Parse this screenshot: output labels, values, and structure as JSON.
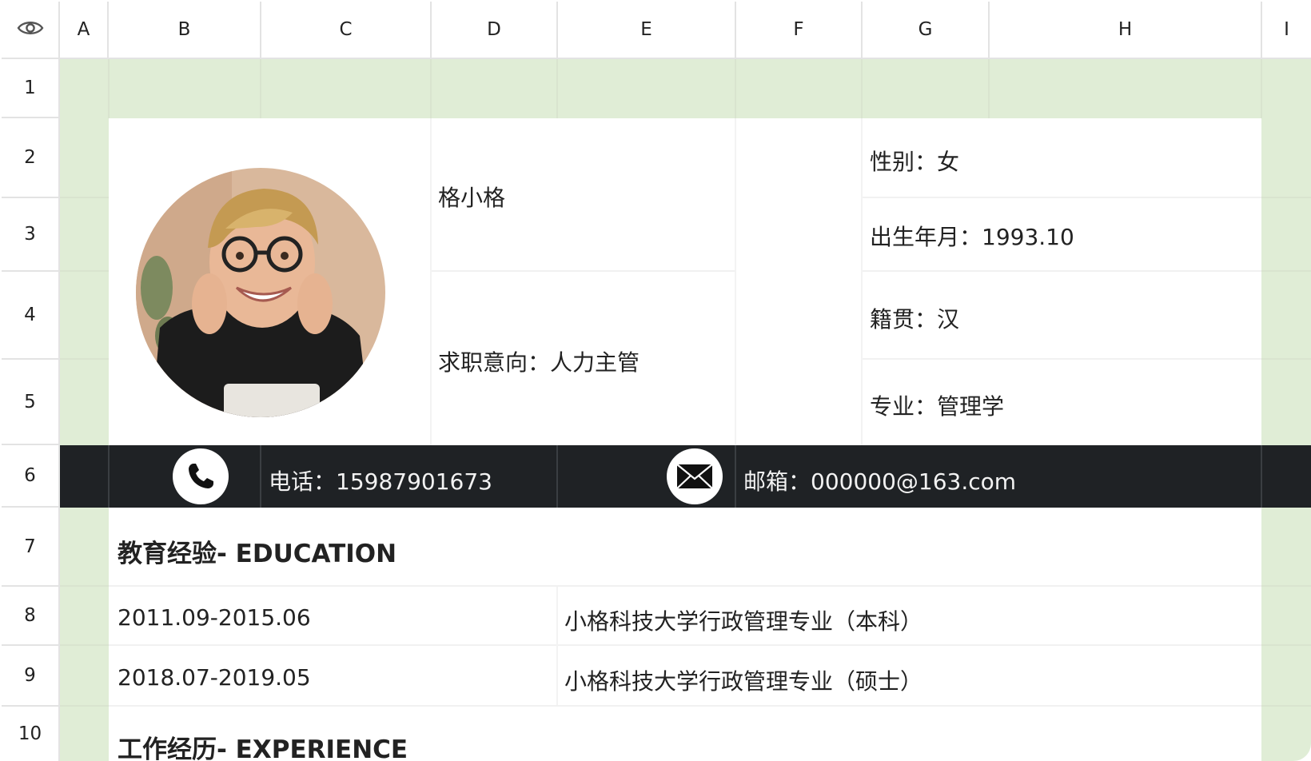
{
  "columns": [
    "A",
    "B",
    "C",
    "D",
    "E",
    "F",
    "G",
    "H",
    "I"
  ],
  "rows": [
    "1",
    "2",
    "3",
    "4",
    "5",
    "6",
    "7",
    "8",
    "9",
    "10"
  ],
  "profile": {
    "name": "格小格",
    "intent": "求职意向：人力主管",
    "gender": "性别：女",
    "birth": "出生年月：1993.10",
    "origin": "籍贯：汉",
    "major": "专业：管理学"
  },
  "contact": {
    "phone": "电话：15987901673",
    "email": "邮箱：000000@163.com"
  },
  "education": {
    "heading": "教育经验- EDUCATION",
    "entries": [
      {
        "period": "2011.09-2015.06",
        "detail": "小格科技大学行政管理专业（本科）"
      },
      {
        "period": "2018.07-2019.05",
        "detail": "小格科技大学行政管理专业（硕士）"
      }
    ]
  },
  "experience": {
    "heading": "工作经历- EXPERIENCE"
  },
  "colors": {
    "green_margin": "#e0edd6",
    "contact_bar": "#1f2225",
    "grid_line": "#e3e3e3"
  },
  "icons": {
    "header_corner": "eye-icon",
    "phone": "phone-icon",
    "email": "envelope-icon",
    "photo": "profile-photo"
  }
}
